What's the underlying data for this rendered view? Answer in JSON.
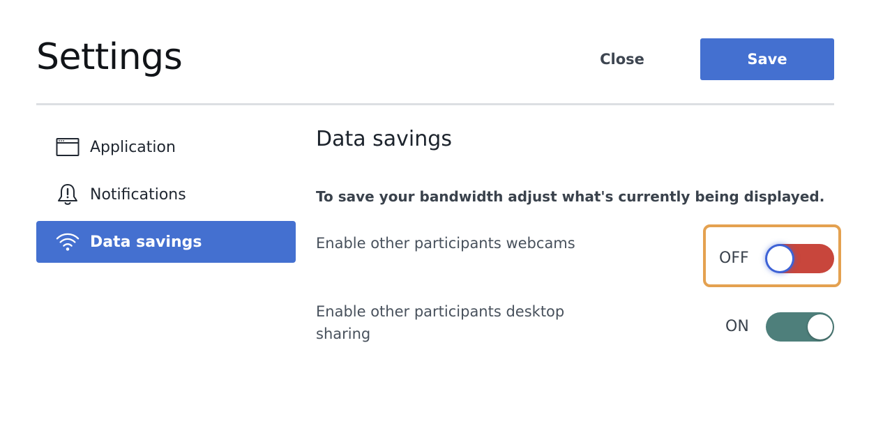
{
  "header": {
    "title": "Settings",
    "close_label": "Close",
    "save_label": "Save"
  },
  "sidebar": {
    "items": [
      {
        "label": "Application",
        "icon": "application-window-icon",
        "active": false
      },
      {
        "label": "Notifications",
        "icon": "bell-alert-icon",
        "active": false
      },
      {
        "label": "Data savings",
        "icon": "wifi-icon",
        "active": true
      }
    ]
  },
  "main": {
    "section_title": "Data savings",
    "description": "To save your bandwidth adjust what's currently being displayed.",
    "settings": [
      {
        "label": "Enable other participants webcams",
        "state_label": "OFF",
        "enabled": false
      },
      {
        "label": "Enable other participants desktop sharing",
        "state_label": "ON",
        "enabled": true
      }
    ]
  },
  "colors": {
    "accent": "#4470d0",
    "toggle_off": "#c8463c",
    "toggle_on": "#4e7f7b",
    "focus_ring": "#3d62d6",
    "highlight": "#e4a150"
  }
}
